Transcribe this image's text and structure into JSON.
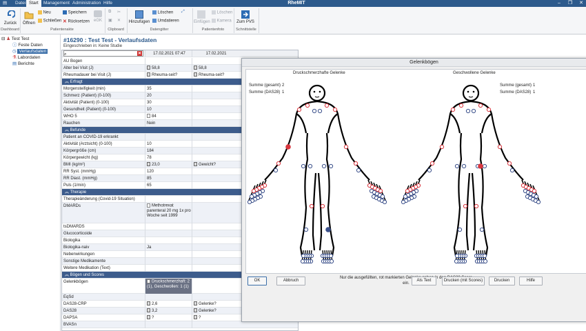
{
  "app": {
    "title": "RheMIT",
    "tabs": [
      "Datei",
      "Start",
      "Management",
      "Administration",
      "Hilfe"
    ]
  },
  "ribbon": {
    "back": "Zurück",
    "open": "Öffnen",
    "new": "Neu",
    "close": "Schließen",
    "save": "Speichern",
    "reset": "Rücksetzen",
    "egk": "eGK",
    "add": "Hinzufügen",
    "delete": "Löschen",
    "rename": "Umdatieren",
    "paste": "Einfügen",
    "photo_delete": "Löschen",
    "camera": "Kamera",
    "to_pvs": "Zum PVS",
    "groups": [
      "Dashboard",
      "Patientenakte",
      "Clipboard",
      "Datengitter",
      "Patientenfoto",
      "Schnittstelle"
    ]
  },
  "tree": {
    "root": "Test Test",
    "items": [
      "Feste Daten",
      "Verlaufsdaten",
      "Labordaten",
      "Berichte"
    ]
  },
  "main": {
    "title": "#16290 : Test Test - Verlaufsdaten",
    "subtitle": "Eingeschrieben in: Keine Studie",
    "col1": "17.02.2021 07:47",
    "col2": "17.02.2021",
    "rows": [
      {
        "t": "n",
        "l": "AU Bogen",
        "a": "",
        "b": ""
      },
      {
        "t": "a",
        "l": "Alter bei Visit (J)",
        "a": "58,8",
        "b": "58,8"
      },
      {
        "t": "a",
        "l": "Rheumadauer bei Visit (J)",
        "a": "Rheuma-seit?",
        "b": "Rheuma-seit?"
      },
      {
        "t": "s",
        "l": "Erfragt"
      },
      {
        "t": "n",
        "l": "Morgensteifigkeit (min)",
        "a": "35",
        "b": ""
      },
      {
        "t": "a",
        "l": "Schmerz (Patient) (0-100)",
        "a": "20",
        "b": ""
      },
      {
        "t": "n",
        "l": "Aktivität (Patient) (0-100)",
        "a": "30",
        "b": ""
      },
      {
        "t": "a",
        "l": "Gesundheit (Patient) (0-100)",
        "a": "10",
        "b": ""
      },
      {
        "t": "n",
        "l": "WHO 5",
        "a": "84",
        "b": ""
      },
      {
        "t": "a",
        "l": "Rauchen",
        "a": "Nein",
        "b": ""
      },
      {
        "t": "s",
        "l": "Befunde"
      },
      {
        "t": "n",
        "l": "Patient an COVID-19 erkrankt",
        "a": "",
        "b": ""
      },
      {
        "t": "n",
        "l": "Aktivität (Arztsicht) (0-100)",
        "a": "10",
        "b": ""
      },
      {
        "t": "a",
        "l": "Körpergröße (cm)",
        "a": "184",
        "b": ""
      },
      {
        "t": "n",
        "l": "Körpergewicht (kg)",
        "a": "78",
        "b": ""
      },
      {
        "t": "a",
        "l": "BMI (kg/m²)",
        "a": "23,0",
        "b": "Gewicht?"
      },
      {
        "t": "n",
        "l": "RR Syst. (mmHg)",
        "a": "120",
        "b": ""
      },
      {
        "t": "a",
        "l": "RR Diast. (mmHg)",
        "a": "85",
        "b": ""
      },
      {
        "t": "n",
        "l": "Puls (1/min)",
        "a": "65",
        "b": ""
      },
      {
        "t": "s",
        "l": "Therapie"
      },
      {
        "t": "n",
        "l": "Therapieänderung (Covid-19 Situation)",
        "a": "",
        "b": ""
      },
      {
        "t": "m",
        "l": "DMARDs",
        "a": "Methotrexat parenteral 20 mg 1x pro Woche seit 1999",
        "b": ""
      },
      {
        "t": "n",
        "l": "tsDMARDS",
        "a": "",
        "b": ""
      },
      {
        "t": "a",
        "l": "Glucocorticoide",
        "a": "",
        "b": ""
      },
      {
        "t": "n",
        "l": "Biologika",
        "a": "",
        "b": ""
      },
      {
        "t": "a",
        "l": "Biologika-naiv",
        "a": "Ja",
        "b": ""
      },
      {
        "t": "n",
        "l": "Nebenwirkungen",
        "a": "",
        "b": ""
      },
      {
        "t": "a",
        "l": "Sonstige Medikamente",
        "a": "",
        "b": ""
      },
      {
        "t": "n",
        "l": "Weitere Medikation (Text)",
        "a": "",
        "b": ""
      },
      {
        "t": "s",
        "l": "Bögen und Scores"
      },
      {
        "t": "g",
        "l": "Gelenkbögen",
        "a": "Druckschmerzhaft: 2 (1), Geschwollen: 1 (1)",
        "b": ""
      },
      {
        "t": "n",
        "l": "EqSd",
        "a": "",
        "b": ""
      },
      {
        "t": "a",
        "l": "DAS28-CRP",
        "a": "2,6",
        "b": "Gelenke?"
      },
      {
        "t": "n",
        "l": "DAS28",
        "a": "3,2",
        "b": "Gelenke?"
      },
      {
        "t": "a",
        "l": "DAPSA",
        "a": "?",
        "b": "?"
      },
      {
        "t": "n",
        "l": "BVASn",
        "a": "",
        "b": ""
      }
    ]
  },
  "dialog": {
    "title": "Gelenkbögen",
    "left_title": "Druckschmerzhafte Gelenke",
    "right_title": "Geschwollene Gelenke",
    "sum_total_label": "Summe (gesamt)",
    "sum_das_label": "Summe (DAS28)",
    "left_total": "2",
    "left_das": "1",
    "right_total": "1",
    "right_das": "1",
    "note": "Nur die ausgefüllten, rot markierten Gelenke gehen in den DAS28 Score ein.",
    "buttons": {
      "ok": "OK",
      "cancel": "Abbruch",
      "as_text": "Als Text",
      "print_scores": "Drucken (mit Scores)",
      "print": "Drucken",
      "help": "Hilfe"
    }
  },
  "colors": {
    "accent": "#2d5a8c",
    "section": "#3d5c8c",
    "das_joint": "#d9363e",
    "other_joint": "#3a4f8a"
  }
}
